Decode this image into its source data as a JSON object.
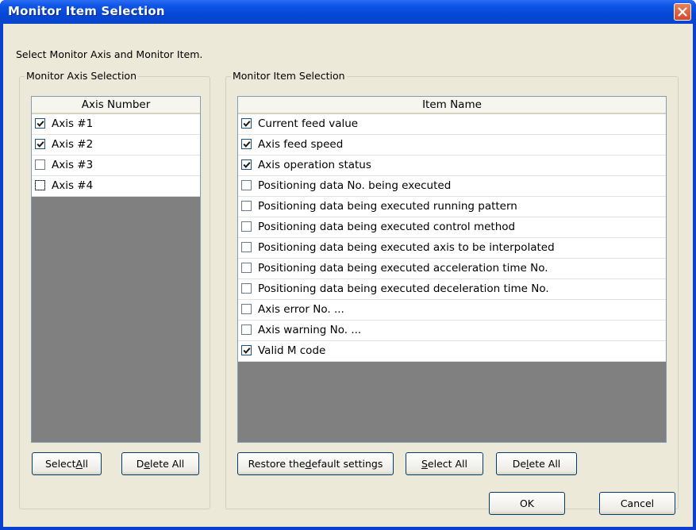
{
  "window": {
    "title": "Monitor Item Selection"
  },
  "instruction": "Select Monitor Axis and Monitor Item.",
  "axis_group": {
    "legend": "Monitor Axis Selection",
    "column_header": "Axis Number",
    "items": [
      {
        "label": "Axis #1",
        "checked": true
      },
      {
        "label": "Axis #2",
        "checked": true
      },
      {
        "label": "Axis #3",
        "checked": false
      },
      {
        "label": "Axis #4",
        "checked": false
      }
    ],
    "select_all_label": "Select All",
    "delete_all_label": "Delete All"
  },
  "item_group": {
    "legend": "Monitor Item Selection",
    "column_header": "Item Name",
    "items": [
      {
        "label": "Current feed value",
        "checked": true
      },
      {
        "label": "Axis feed speed",
        "checked": true
      },
      {
        "label": "Axis operation status",
        "checked": true
      },
      {
        "label": "Positioning data No. being executed",
        "checked": false
      },
      {
        "label": "Positioning data being executed running pattern",
        "checked": false
      },
      {
        "label": "Positioning data being executed control method",
        "checked": false
      },
      {
        "label": "Positioning data being executed axis to be interpolated",
        "checked": false
      },
      {
        "label": "Positioning data being executed acceleration time No.",
        "checked": false
      },
      {
        "label": "Positioning data being executed deceleration time No.",
        "checked": false
      },
      {
        "label": "Axis error No. ...",
        "checked": false
      },
      {
        "label": "Axis warning No. ...",
        "checked": false
      },
      {
        "label": "Valid M code",
        "checked": true
      }
    ],
    "restore_label": "Restore the default settings",
    "select_all_label": "Select All",
    "delete_all_label": "Delete All"
  },
  "footer": {
    "ok_label": "OK",
    "cancel_label": "Cancel"
  },
  "icons": {
    "close": "close-icon",
    "check": "checkmark-icon"
  },
  "colors": {
    "titlebar": "#0447d6",
    "close_button": "#d4492a",
    "dialog_bg": "#ece9d8",
    "list_empty_bg": "#808080"
  }
}
